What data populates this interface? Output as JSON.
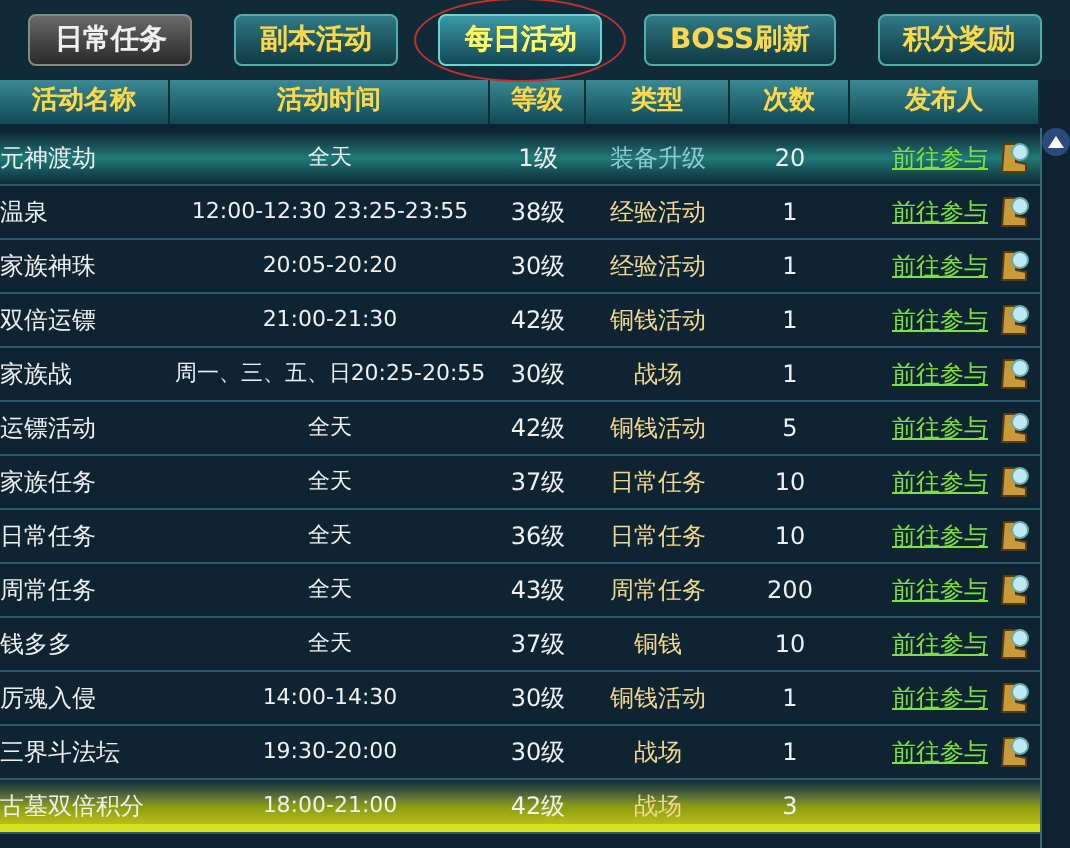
{
  "tabs": [
    {
      "label": "日常任务",
      "kind": "grey",
      "selected": false
    },
    {
      "label": "副本活动",
      "kind": "gold",
      "selected": false
    },
    {
      "label": "每日活动",
      "kind": "gold",
      "selected": true
    },
    {
      "label": "BOSS刷新",
      "kind": "gold",
      "selected": false
    },
    {
      "label": "积分奖励",
      "kind": "gold",
      "selected": false
    }
  ],
  "table": {
    "columns": [
      "活动名称",
      "活动时间",
      "等级",
      "类型",
      "次数",
      "发布人"
    ],
    "rows": [
      {
        "name": "元神渡劫",
        "time": "全天",
        "level": "1级",
        "type": "装备升级",
        "color": "#8fc7d6",
        "count": "20",
        "link": "前往参与",
        "selected": true,
        "hovered": false
      },
      {
        "name": "温泉",
        "time": "12:00-12:30 23:25-23:55",
        "level": "38级",
        "type": "经验活动",
        "color": "#f0d890",
        "count": "1",
        "link": "前往参与",
        "selected": false,
        "hovered": false
      },
      {
        "name": "家族神珠",
        "time": "20:05-20:20",
        "level": "30级",
        "type": "经验活动",
        "color": "#f0d890",
        "count": "1",
        "link": "前往参与",
        "selected": false,
        "hovered": false
      },
      {
        "name": "双倍运镖",
        "time": "21:00-21:30",
        "level": "42级",
        "type": "铜钱活动",
        "color": "#f0d890",
        "count": "1",
        "link": "前往参与",
        "selected": false,
        "hovered": false
      },
      {
        "name": "家族战",
        "time": "周一、三、五、日20:25-20:55",
        "level": "30级",
        "type": "战场",
        "color": "#f0d890",
        "count": "1",
        "link": "前往参与",
        "selected": false,
        "hovered": false
      },
      {
        "name": "运镖活动",
        "time": "全天",
        "level": "42级",
        "type": "铜钱活动",
        "color": "#f0d890",
        "count": "5",
        "link": "前往参与",
        "selected": false,
        "hovered": false
      },
      {
        "name": "家族任务",
        "time": "全天",
        "level": "37级",
        "type": "日常任务",
        "color": "#f0d890",
        "count": "10",
        "link": "前往参与",
        "selected": false,
        "hovered": false
      },
      {
        "name": "日常任务",
        "time": "全天",
        "level": "36级",
        "type": "日常任务",
        "color": "#f0d890",
        "count": "10",
        "link": "前往参与",
        "selected": false,
        "hovered": false
      },
      {
        "name": "周常任务",
        "time": "全天",
        "level": "43级",
        "type": "周常任务",
        "color": "#f0d890",
        "count": "200",
        "link": "前往参与",
        "selected": false,
        "hovered": false
      },
      {
        "name": "钱多多",
        "time": "全天",
        "level": "37级",
        "type": "铜钱",
        "color": "#f0d890",
        "count": "10",
        "link": "前往参与",
        "selected": false,
        "hovered": false
      },
      {
        "name": "厉魂入侵",
        "time": "14:00-14:30",
        "level": "30级",
        "type": "铜钱活动",
        "color": "#f0d890",
        "count": "1",
        "link": "前往参与",
        "selected": false,
        "hovered": false
      },
      {
        "name": "三界斗法坛",
        "time": "19:30-20:00",
        "level": "30级",
        "type": "战场",
        "color": "#f0d890",
        "count": "1",
        "link": "前往参与",
        "selected": false,
        "hovered": false
      },
      {
        "name": "古墓双倍积分",
        "time": "18:00-21:00",
        "level": "42级",
        "type": "战场",
        "color": "#f0d890",
        "count": "3",
        "selected": false,
        "hovered": true
      }
    ]
  }
}
